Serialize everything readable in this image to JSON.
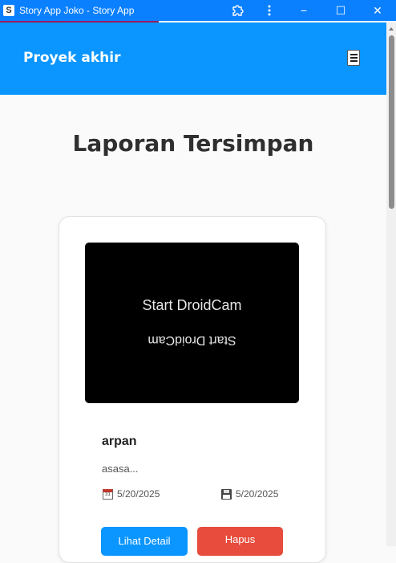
{
  "window": {
    "icon_glyph": "S",
    "title": "Story App Joko - Story App",
    "extension_icon": "puzzle-icon",
    "more_icon": "more-vertical-icon",
    "minimize_glyph": "−",
    "maximize_glyph": "☐",
    "close_glyph": "✕"
  },
  "header": {
    "brand": "Proyek akhir",
    "menu_icon": "hamburger-icon"
  },
  "main": {
    "title": "Laporan Tersimpan"
  },
  "story": {
    "image_text_top": "Start DroidCam",
    "image_text_mirrored": "Start DroidCam",
    "name": "arpan",
    "description": "asasa...",
    "date_created": "5/20/2025",
    "date_saved": "5/20/2025",
    "detail_label": "Lihat Detail",
    "delete_label": "Hapus"
  },
  "colors": {
    "titlebar": "#0a80ff",
    "appbar": "#0b96ff",
    "primary_button": "#0b96ff",
    "danger_button": "#e74c3c"
  }
}
